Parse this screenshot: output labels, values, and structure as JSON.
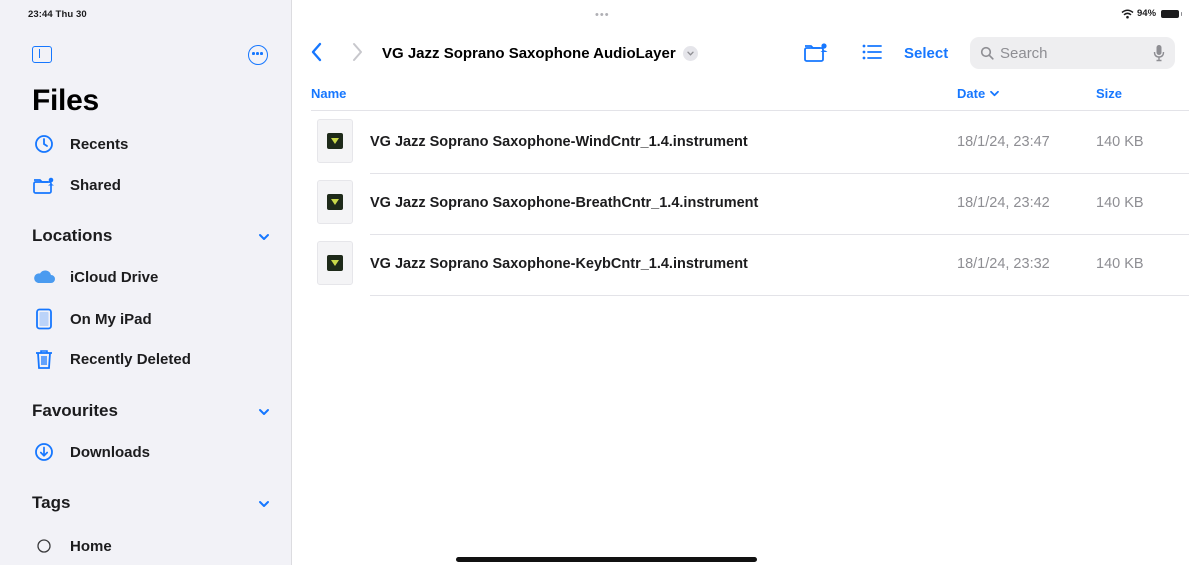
{
  "status": {
    "time": "23:44  Thu 30",
    "battery_pct": "94%",
    "multitask_dots": "•••"
  },
  "sidebar": {
    "title": "Files",
    "items_top": [
      {
        "label": "Recents",
        "icon": "clock-icon"
      },
      {
        "label": "Shared",
        "icon": "shared-folder-icon"
      }
    ],
    "locations": {
      "title": "Locations",
      "items": [
        {
          "label": "iCloud Drive",
          "icon": "icloud-icon"
        },
        {
          "label": "On My iPad",
          "icon": "ipad-icon"
        },
        {
          "label": "Recently Deleted",
          "icon": "trash-icon"
        }
      ]
    },
    "favourites": {
      "title": "Favourites",
      "items": [
        {
          "label": "Downloads",
          "icon": "download-icon"
        }
      ]
    },
    "tags": {
      "title": "Tags",
      "items": [
        {
          "label": "Home",
          "icon": "tag-circle-icon"
        }
      ]
    }
  },
  "toolbar": {
    "folder_title": "VG Jazz Soprano Saxophone AudioLayer",
    "select_label": "Select",
    "search_placeholder": "Search"
  },
  "columns": {
    "name": "Name",
    "date": "Date",
    "size": "Size",
    "sort": "date-descending"
  },
  "files": [
    {
      "name": "VG Jazz Soprano Saxophone-WindCntr_1.4.instrument",
      "date": "18/1/24, 23:47",
      "size": "140 KB"
    },
    {
      "name": "VG Jazz Soprano Saxophone-BreathCntr_1.4.instrument",
      "date": "18/1/24, 23:42",
      "size": "140 KB"
    },
    {
      "name": "VG Jazz Soprano Saxophone-KeybCntr_1.4.instrument",
      "date": "18/1/24, 23:32",
      "size": "140 KB"
    }
  ],
  "colors": {
    "accent": "#1677ff",
    "sidebar_bg": "#f2f2f7",
    "secondary_text": "#8e8e93"
  }
}
